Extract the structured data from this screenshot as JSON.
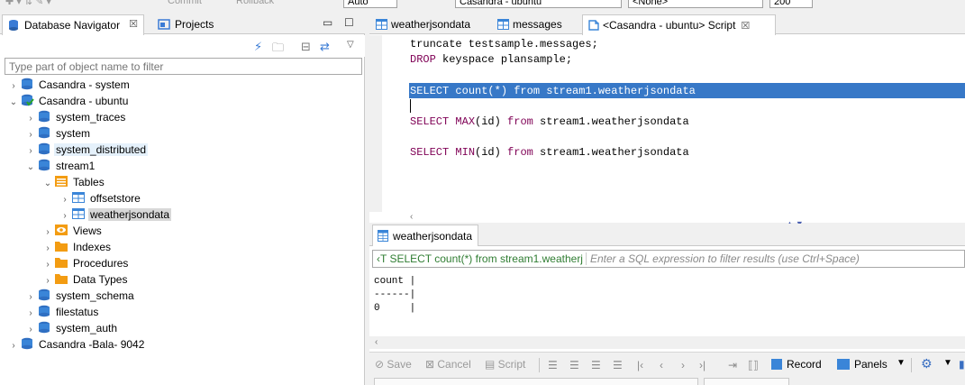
{
  "top_toolbar": {
    "commit_label": "Commit",
    "rollback_label": "Rollback",
    "mode_value": "Auto",
    "connection_value": "Casandra - ubuntu",
    "schema_value": "<None>",
    "limit_value": "200"
  },
  "left_panel": {
    "tab_navigator": "Database Navigator",
    "tab_projects": "Projects",
    "filter_placeholder": "Type part of object name to filter",
    "tree": [
      {
        "label": "Casandra - system",
        "icon": "database-icon",
        "arrow": "›"
      },
      {
        "label": "Casandra - ubuntu",
        "icon": "database-connected-icon",
        "arrow": "⌄"
      },
      {
        "label": "system_traces",
        "icon": "database-icon",
        "arrow": "›"
      },
      {
        "label": "system",
        "icon": "database-icon",
        "arrow": "›"
      },
      {
        "label": "system_distributed",
        "icon": "database-icon",
        "arrow": "›"
      },
      {
        "label": "stream1",
        "icon": "database-icon",
        "arrow": "⌄"
      },
      {
        "label": "Tables",
        "icon": "tables-folder-icon",
        "arrow": "⌄"
      },
      {
        "label": "offsetstore",
        "icon": "table-icon",
        "arrow": "›"
      },
      {
        "label": "weatherjsondata",
        "icon": "table-icon",
        "arrow": "›"
      },
      {
        "label": "Views",
        "icon": "views-icon",
        "arrow": "›"
      },
      {
        "label": "Indexes",
        "icon": "folder-icon",
        "arrow": "›"
      },
      {
        "label": "Procedures",
        "icon": "folder-icon",
        "arrow": "›"
      },
      {
        "label": "Data Types",
        "icon": "folder-icon",
        "arrow": "›"
      },
      {
        "label": "system_schema",
        "icon": "database-icon",
        "arrow": "›"
      },
      {
        "label": "filestatus",
        "icon": "database-icon",
        "arrow": "›"
      },
      {
        "label": "system_auth",
        "icon": "database-icon",
        "arrow": "›"
      },
      {
        "label": "Casandra -Bala- 9042",
        "icon": "database-icon",
        "arrow": "›"
      }
    ]
  },
  "editor": {
    "tabs": [
      {
        "label": "weatherjsondata",
        "icon": "table-icon"
      },
      {
        "label": "messages",
        "icon": "table-icon"
      },
      {
        "label": "<Casandra - ubuntu> Script",
        "icon": "script-icon"
      }
    ],
    "lines": {
      "l1": "truncate testsample.messages;",
      "l2a": "DROP",
      "l2b": " keyspace plansample;",
      "l3a": "SELECT",
      "l3b": " count(*) ",
      "l3c": "from",
      "l3d": " stream1.weatherjsondata",
      "l4a": "SELECT",
      "l4b": " MAX",
      "l4c": "(id) ",
      "l4d": "from",
      "l4e": " stream1.weatherjsondata",
      "l5a": "SELECT",
      "l5b": " MIN",
      "l5c": "(id) ",
      "l5d": "from",
      "l5e": " stream1.weatherjsondata"
    }
  },
  "results": {
    "tab_label": "weatherjsondata",
    "query_text": "SELECT count(*) from stream1.weatherj",
    "filter_placeholder": "Enter a SQL expression to filter results (use Ctrl+Space)",
    "output_lines": [
      "count |",
      "------|",
      "0     |"
    ],
    "buttons": {
      "save": "Save",
      "cancel": "Cancel",
      "script": "Script",
      "record": "Record",
      "panels": "Panels"
    }
  },
  "colors": {
    "selection": "#3778c7",
    "keyword": "#7f0055",
    "filter_query": "#2f7d32"
  }
}
